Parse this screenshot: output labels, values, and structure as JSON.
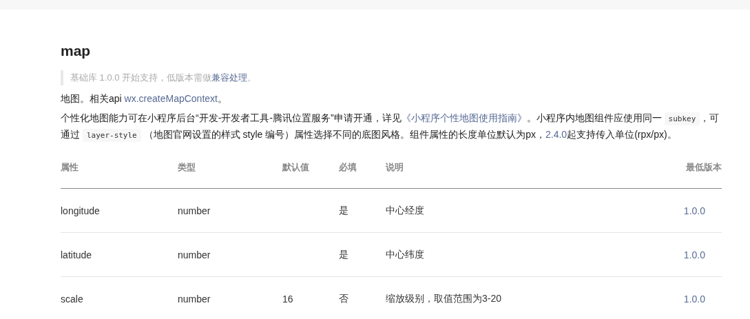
{
  "title": "map",
  "note": [
    {
      "kind": "text",
      "text": "基础库 1.0.0 开始支持，低版本需做"
    },
    {
      "kind": "link",
      "text": "兼容处理"
    },
    {
      "kind": "text",
      "text": "。"
    }
  ],
  "paragraphs": [
    [
      {
        "kind": "text",
        "text": "地图。相关api "
      },
      {
        "kind": "link",
        "text": "wx.createMapContext"
      },
      {
        "kind": "text",
        "text": "。"
      }
    ],
    [
      {
        "kind": "text",
        "text": "个性化地图能力可在小程序后台“开发-开发者工具-腾讯位置服务”申请开通，详见"
      },
      {
        "kind": "link",
        "text": "《小程序个性地图使用指南》"
      },
      {
        "kind": "text",
        "text": "。小程序内地图组件应使用同一 "
      },
      {
        "kind": "code",
        "text": "subkey"
      },
      {
        "kind": "text",
        "text": "，可通过 "
      },
      {
        "kind": "code",
        "text": "layer-style"
      },
      {
        "kind": "text",
        "text": " （地图官网设置的样式 style 编号）属性选择不同的底图风格。组件属性的长度单位默认为px，"
      },
      {
        "kind": "link",
        "text": "2.4.0"
      },
      {
        "kind": "text",
        "text": "起支持传入单位(rpx/px)。"
      }
    ]
  ],
  "table": {
    "columns": [
      "属性",
      "类型",
      "默认值",
      "必填",
      "说明",
      "最低版本"
    ],
    "rows": [
      [
        "longitude",
        "number",
        "",
        "是",
        "中心经度",
        "1.0.0"
      ],
      [
        "latitude",
        "number",
        "",
        "是",
        "中心纬度",
        "1.0.0"
      ],
      [
        "scale",
        "number",
        "16",
        "否",
        "缩放级别，取值范围为3-20",
        "1.0.0"
      ]
    ]
  }
}
